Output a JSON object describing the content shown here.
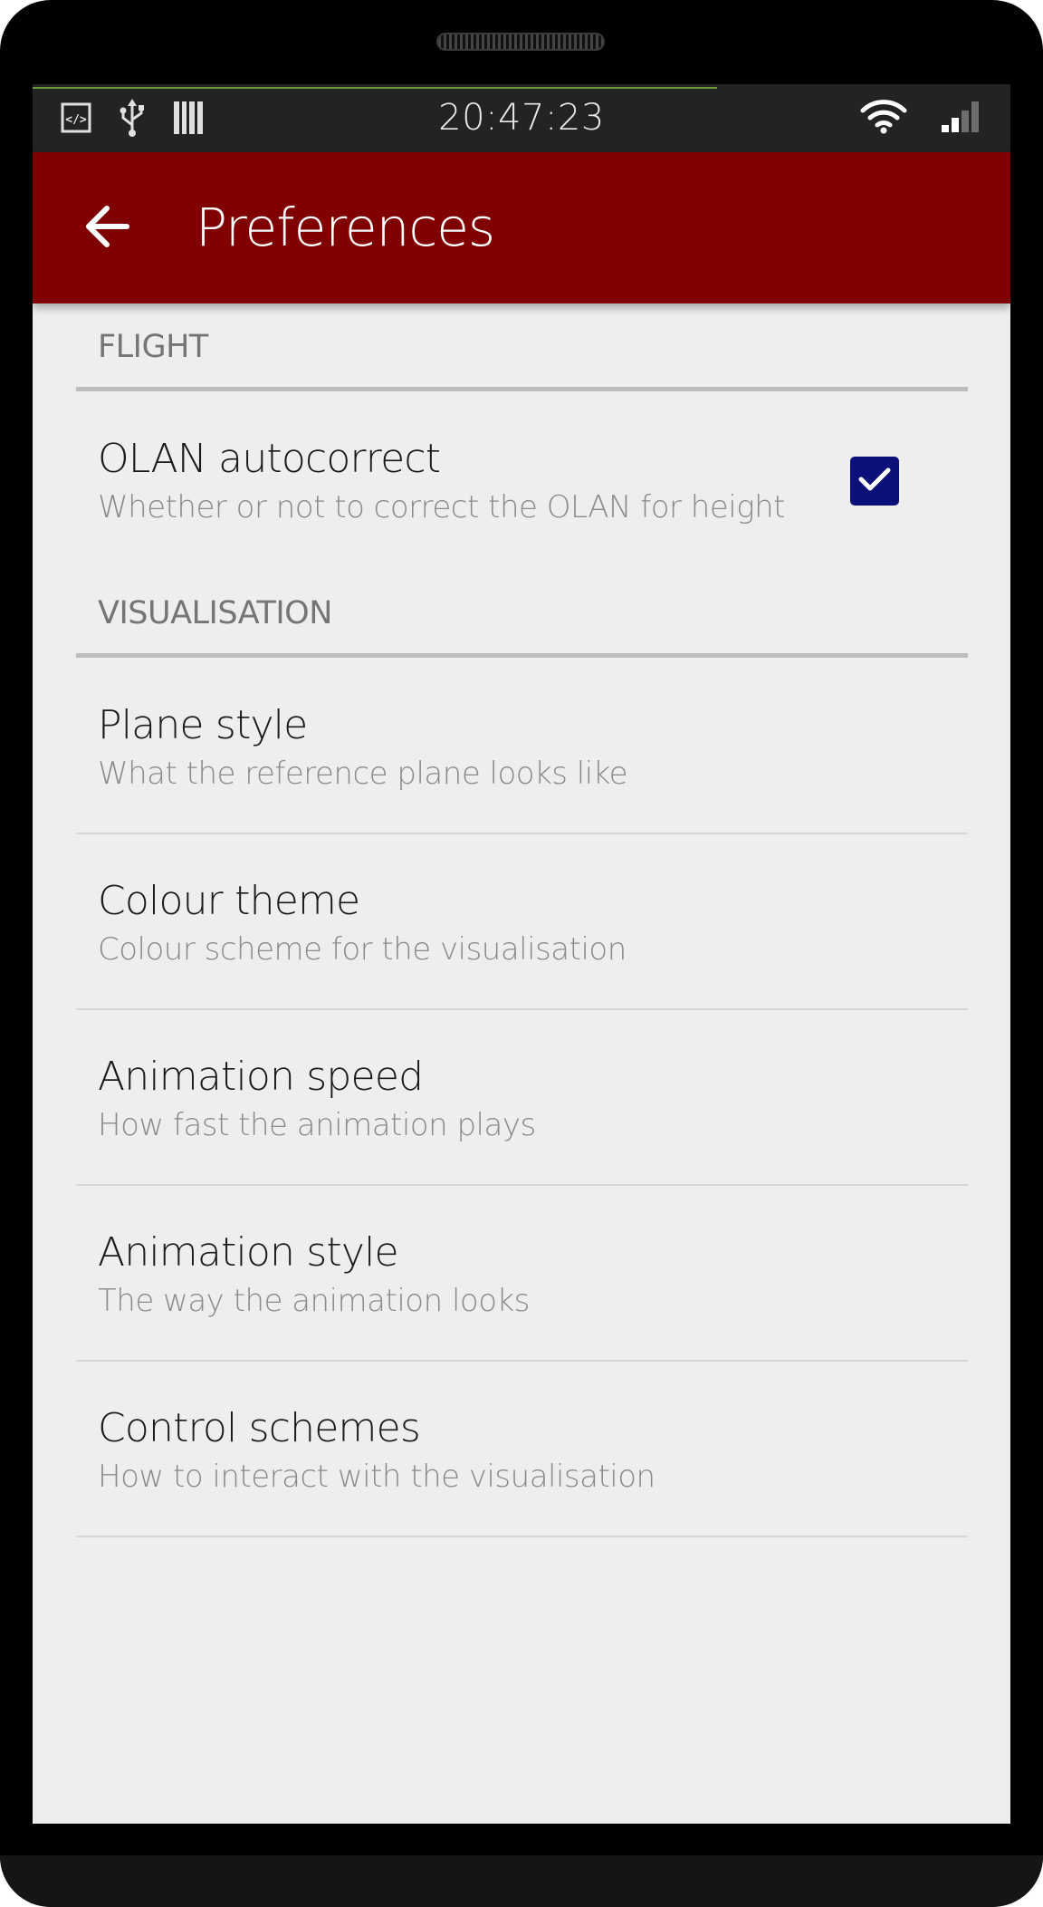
{
  "status_bar": {
    "time": "20:47:23",
    "left_icons": [
      "code-icon",
      "usb-icon",
      "barcode-icon"
    ],
    "right_icons": [
      "wifi-icon",
      "signal-icon"
    ],
    "background": "#232323"
  },
  "app_bar": {
    "title": "Preferences",
    "back_icon": "arrow-back-icon",
    "background": "#800000"
  },
  "categories": [
    {
      "label": "FLIGHT",
      "items": [
        {
          "title": "OLAN autocorrect",
          "summary": "Whether or not to correct the OLAN for height",
          "checkbox": {
            "checked": true,
            "color": "#0a0f7a"
          }
        }
      ]
    },
    {
      "label": "VISUALISATION",
      "items": [
        {
          "title": "Plane style",
          "summary": "What the reference plane looks like"
        },
        {
          "title": "Colour theme",
          "summary": "Colour scheme for the visualisation"
        },
        {
          "title": "Animation speed",
          "summary": "How fast the animation plays"
        },
        {
          "title": "Animation style",
          "summary": "The way the animation looks"
        },
        {
          "title": "Control schemes",
          "summary": "How to interact with the visualisation"
        }
      ]
    }
  ]
}
